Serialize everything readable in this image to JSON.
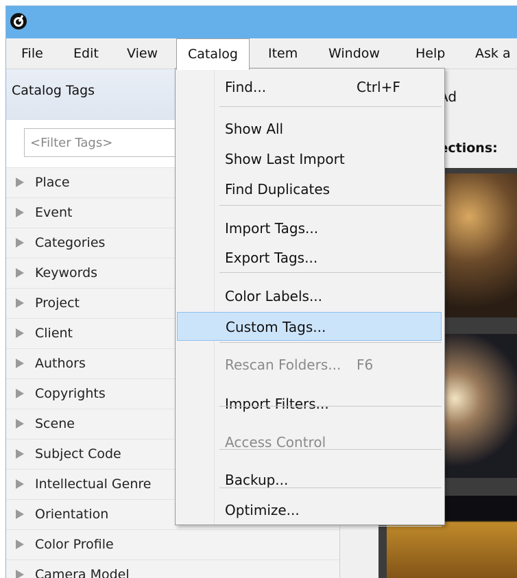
{
  "menubar": {
    "items": [
      {
        "label": "File"
      },
      {
        "label": "Edit"
      },
      {
        "label": "View"
      },
      {
        "label": "Catalog"
      },
      {
        "label": "Item"
      },
      {
        "label": "Window"
      },
      {
        "label": "Help"
      },
      {
        "label": "Ask a"
      }
    ]
  },
  "left_panel": {
    "title": "Catalog Tags",
    "filter_placeholder": "<Filter Tags>",
    "tags": [
      "Place",
      "Event",
      "Categories",
      "Keywords",
      "Project",
      "Client",
      "Authors",
      "Copyrights",
      "Scene",
      "Subject Code",
      "Intellectual Genre",
      "Orientation",
      "Color Profile",
      "Camera Model"
    ]
  },
  "right_area": {
    "add_label": "Ad",
    "collections_label": "lections:"
  },
  "catalog_menu": {
    "items": [
      {
        "label": "Find...",
        "shortcut": "Ctrl+F"
      },
      {
        "label": "Show All",
        "shortcut": ""
      },
      {
        "label": "Show Last Import",
        "shortcut": ""
      },
      {
        "label": "Find Duplicates",
        "shortcut": ""
      },
      {
        "label": "Import Tags...",
        "shortcut": ""
      },
      {
        "label": "Export Tags...",
        "shortcut": ""
      },
      {
        "label": "Color Labels...",
        "shortcut": ""
      },
      {
        "label": "Custom Tags...",
        "shortcut": "",
        "highlighted": true
      },
      {
        "label": "Rescan Folders...",
        "shortcut": "F6",
        "disabled": true
      },
      {
        "label": "Import Filters...",
        "shortcut": ""
      },
      {
        "label": "Access Control",
        "shortcut": "",
        "disabled": true
      },
      {
        "label": "Backup...",
        "shortcut": ""
      },
      {
        "label": "Optimize...",
        "shortcut": ""
      }
    ]
  },
  "colors": {
    "titlebar": "#65b0ea",
    "menu_highlight": "#cce4fa",
    "menu_highlight_border": "#8cc0ee"
  }
}
